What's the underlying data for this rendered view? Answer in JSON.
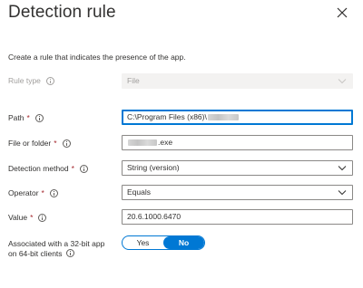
{
  "panel": {
    "title": "Detection rule",
    "description": "Create a rule that indicates the presence of the app."
  },
  "fields": {
    "rule_type": {
      "label": "Rule type",
      "value": "File"
    },
    "path": {
      "label": "Path",
      "value_prefix": "C:\\Program Files (x86)\\"
    },
    "file_or_folder": {
      "label": "File or folder",
      "value_suffix": ".exe"
    },
    "detection_method": {
      "label": "Detection method",
      "value": "String (version)"
    },
    "operator": {
      "label": "Operator",
      "value": "Equals"
    },
    "value": {
      "label": "Value",
      "value": "20.6.1000.6470"
    },
    "associated_32bit": {
      "label_line1": "Associated with a 32-bit app",
      "label_line2": "on 64-bit clients",
      "options": [
        "Yes",
        "No"
      ],
      "selected": "No"
    }
  },
  "required_marker": "*",
  "icons": {
    "close": "close-icon",
    "info": "info-icon",
    "dropdown": "chevron-down-icon"
  },
  "colors": {
    "accent": "#0078d4",
    "required": "#a4262c",
    "text": "#323130",
    "disabled_text": "#a19f9d",
    "disabled_bg": "#f3f2f1"
  }
}
